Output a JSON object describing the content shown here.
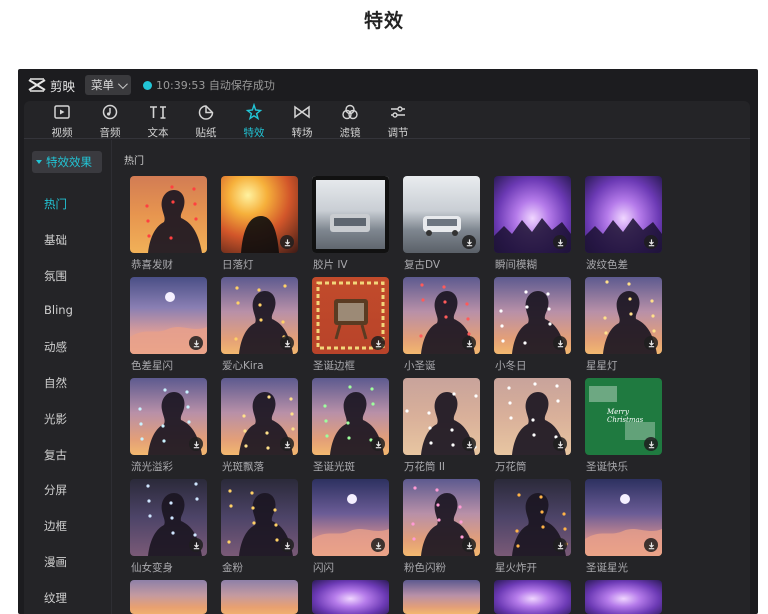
{
  "page_heading": "特效",
  "app": {
    "name": "剪映",
    "menu_label": "菜单",
    "save_status": "10:39:53 自动保存成功",
    "accent_color": "#22c5d6"
  },
  "toolbar": {
    "items": [
      {
        "label": "视频",
        "icon": "video-play-icon"
      },
      {
        "label": "音频",
        "icon": "audio-note-icon"
      },
      {
        "label": "文本",
        "icon": "text-ti-icon"
      },
      {
        "label": "贴纸",
        "icon": "sticker-icon"
      },
      {
        "label": "特效",
        "icon": "sparkle-effects-icon",
        "active": true
      },
      {
        "label": "转场",
        "icon": "transition-bowtie-icon"
      },
      {
        "label": "滤镜",
        "icon": "filter-circles-icon"
      },
      {
        "label": "调节",
        "icon": "adjust-sliders-icon"
      }
    ]
  },
  "sidebar": {
    "header": "特效效果",
    "items": [
      "热门",
      "基础",
      "氛围",
      "Bling",
      "动感",
      "自然",
      "光影",
      "复古",
      "分屏",
      "边框",
      "漫画",
      "纹理"
    ],
    "active_index": 0
  },
  "content": {
    "section_label": "热门",
    "effects": [
      "恭喜发财",
      "日落灯",
      "胶片 IV",
      "复古DV",
      "瞬间模糊",
      "波纹色差",
      "色差星闪",
      "爱心Kira",
      "圣诞边框",
      "小圣诞",
      "小冬日",
      "星星灯",
      "流光溢彩",
      "光斑飘落",
      "圣诞光斑",
      "万花筒 II",
      "万花筒",
      "圣诞快乐",
      "仙女变身",
      "金粉",
      "闪闪",
      "粉色闪粉",
      "星火炸开",
      "圣诞星光"
    ],
    "tile_text": [
      "Merry",
      "Christmas"
    ]
  }
}
